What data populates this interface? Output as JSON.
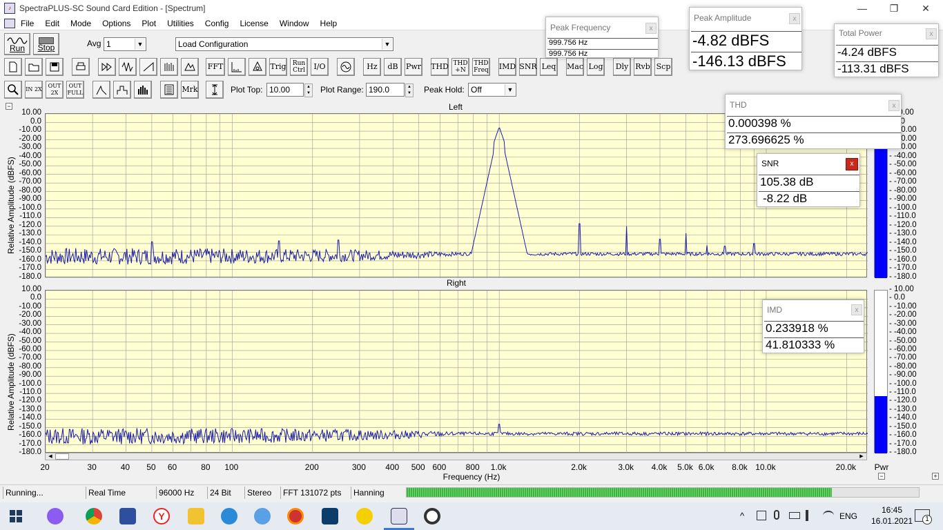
{
  "window": {
    "title": "SpectraPLUS-SC Sound Card Edition - [Spectrum]",
    "minimize": "—",
    "restore": "❐",
    "close": "✕"
  },
  "menu": [
    "File",
    "Edit",
    "Mode",
    "Options",
    "Plot",
    "Utilities",
    "Config",
    "License",
    "Window",
    "Help"
  ],
  "toolbar1": {
    "run_label": "Run",
    "stop_label": "Stop",
    "avg_label": "Avg",
    "avg_value": "1",
    "config_value": "Load Configuration"
  },
  "toolbar2": {
    "buttons": [
      "FFT",
      "Trig",
      "Run Ctrl",
      "I/O",
      "Hz",
      "dB",
      "Pwr",
      "THD",
      "THD +N",
      "THD Freq",
      "IMD",
      "SNR",
      "Leq",
      "Mac",
      "Log",
      "Dly",
      "Rvb",
      "Scp"
    ]
  },
  "toolbar3": {
    "zoom_in": "IN 2X",
    "zoom_out": "OUT 2X",
    "zoom_full": "OUT FULL",
    "mrk": "Mrk",
    "plot_top_label": "Plot Top:",
    "plot_top_value": "10.00",
    "plot_range_label": "Plot Range:",
    "plot_range_value": "190.0",
    "peak_hold_label": "Peak Hold:",
    "peak_hold_value": "Off"
  },
  "popups": {
    "peak_frequency": {
      "title": "Peak Frequency",
      "v1": "999.756 Hz",
      "v2": "999.756 Hz",
      "close": "x"
    },
    "peak_amplitude": {
      "title": "Peak Amplitude",
      "v1": "-4.82 dBFS",
      "v2": "-146.13 dBFS",
      "close": "x"
    },
    "total_power": {
      "title": "Total Power",
      "v1": "-4.24 dBFS",
      "v2": "-113.31 dBFS",
      "close": "x"
    },
    "thd": {
      "title": "THD",
      "v1": "0.000398 %",
      "v2": "273.696625 %",
      "close": "x"
    },
    "snr": {
      "title": "SNR",
      "v1": "105.38 dB",
      "v2": "-8.22 dB",
      "close": "x"
    },
    "imd": {
      "title": "IMD",
      "v1": "0.233918 %",
      "v2": "41.810333 %",
      "close": "x"
    }
  },
  "plots": {
    "left_title": "Left",
    "right_title": "Right",
    "y_axis_title": "Relative Amplitude (dBFS)",
    "x_axis_title": "Frequency (Hz)",
    "pwr_label": "Pwr",
    "collapse_symbol": "−",
    "plus_symbol": "+",
    "line_color": "#1a1aa8",
    "background_color": "#ffffd2"
  },
  "chart_data": [
    {
      "type": "line",
      "title": "Left",
      "xlabel": "Frequency (Hz)",
      "ylabel": "Relative Amplitude (dBFS)",
      "x_scale": "log",
      "xlim": [
        20,
        24000
      ],
      "ylim": [
        -180,
        10
      ],
      "y_ticks": [
        "10.00",
        "0.0",
        "-10.00",
        "-20.00",
        "-30.00",
        "-40.00",
        "-50.00",
        "-60.00",
        "-70.00",
        "-80.00",
        "-90.00",
        "-100.0",
        "-110.0",
        "-120.0",
        "-130.0",
        "-140.0",
        "-150.0",
        "-160.0",
        "-170.0",
        "-180.0"
      ],
      "x_ticks": [
        "20",
        "30",
        "40",
        "50",
        "60",
        "80",
        "100",
        "200",
        "300",
        "400",
        "500",
        "600",
        "800",
        "1.0k",
        "2.0k",
        "3.0k",
        "4.0k",
        "5.0k",
        "6.0k",
        "8.0k",
        "10.0k",
        "20.0k"
      ],
      "noise_floor_db": -152,
      "peaks": [
        {
          "x": 50,
          "y": -138
        },
        {
          "x": 150,
          "y": -137
        },
        {
          "x": 250,
          "y": -136
        },
        {
          "x": 1000,
          "y": -5
        },
        {
          "x": 2000,
          "y": -117
        },
        {
          "x": 3000,
          "y": -120
        },
        {
          "x": 4000,
          "y": -135
        },
        {
          "x": 5000,
          "y": -128
        },
        {
          "x": 6000,
          "y": -142
        },
        {
          "x": 7000,
          "y": -143
        },
        {
          "x": 9000,
          "y": -140
        }
      ],
      "meter_level_db": -4.24
    },
    {
      "type": "line",
      "title": "Right",
      "xlabel": "Frequency (Hz)",
      "ylabel": "Relative Amplitude (dBFS)",
      "x_scale": "log",
      "xlim": [
        20,
        24000
      ],
      "ylim": [
        -180,
        10
      ],
      "y_ticks": [
        "10.00",
        "0.0",
        "-10.00",
        "-20.00",
        "-30.00",
        "-40.00",
        "-50.00",
        "-60.00",
        "-70.00",
        "-80.00",
        "-90.00",
        "-100.0",
        "-110.0",
        "-120.0",
        "-130.0",
        "-140.0",
        "-150.0",
        "-160.0",
        "-170.0",
        "-180.0"
      ],
      "x_ticks": [
        "20",
        "30",
        "40",
        "50",
        "60",
        "80",
        "100",
        "200",
        "300",
        "400",
        "500",
        "600",
        "800",
        "1.0k",
        "2.0k",
        "3.0k",
        "4.0k",
        "5.0k",
        "6.0k",
        "8.0k",
        "10.0k",
        "20.0k"
      ],
      "noise_floor_db": -157,
      "peaks": [
        {
          "x": 1000,
          "y": -146
        }
      ],
      "meter_level_db": -113.31
    }
  ],
  "status": {
    "state": "Running...",
    "mode": "Real Time",
    "rate": "96000 Hz",
    "bits": "24 Bit",
    "channels": "Stereo",
    "fft": "FFT 131072 pts",
    "window": "Hanning",
    "progress_fraction": 0.83
  },
  "taskbar": {
    "lang": "ENG",
    "time": "16:45",
    "date": "16.01.2021",
    "notifications": "1",
    "tray_caret": "^"
  }
}
